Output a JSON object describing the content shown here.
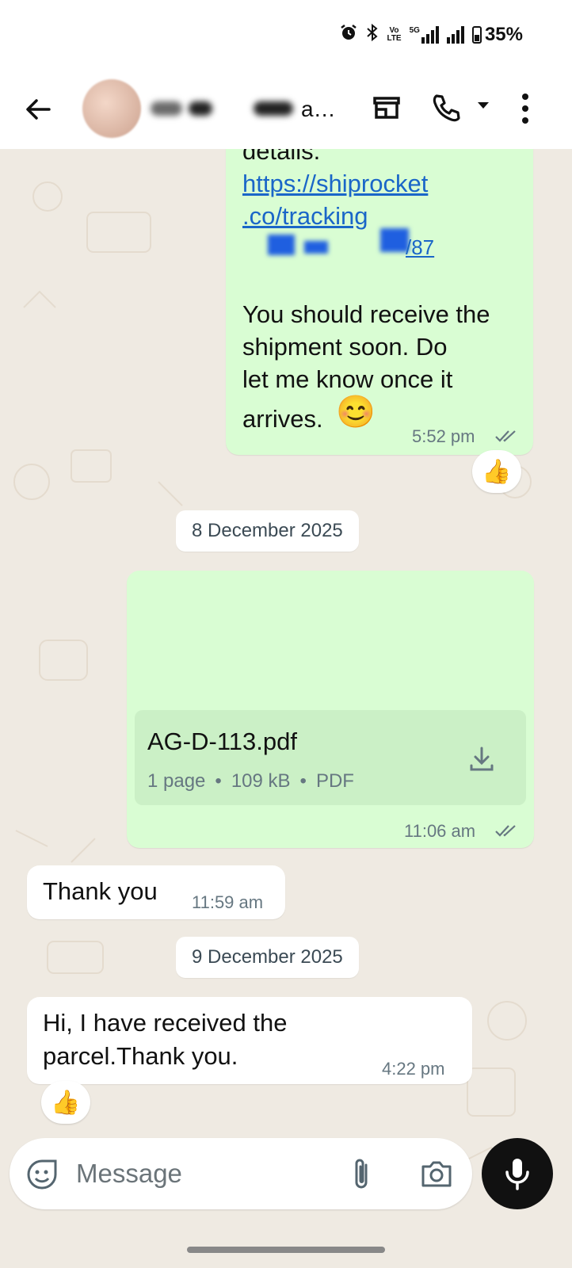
{
  "status_bar": {
    "network_label": "5G",
    "volte_label": "Vo",
    "lte_label": "LTE",
    "battery_percent": "35%"
  },
  "header": {
    "contact_name_visible": "a…"
  },
  "messages": [
    {
      "direction": "out",
      "partial_top": "details.",
      "link_line1": "https://shiprocket",
      "link_line2": ".co/tracking",
      "link_line3": "/87",
      "body": [
        "You should receive the",
        "shipment soon.  Do",
        "let me know once it",
        "arrives."
      ],
      "emoji": "😊",
      "time": "5:52 pm",
      "reaction": "👍"
    },
    {
      "date_separator": "8 December 2025"
    },
    {
      "direction": "out",
      "document": {
        "filename": "AG-D-113.pdf",
        "pages": "1 page",
        "size": "109 kB",
        "type": "PDF"
      },
      "time": "11:06 am"
    },
    {
      "direction": "in",
      "body": "Thank you",
      "time": "11:59 am"
    },
    {
      "date_separator": "9 December 2025"
    },
    {
      "direction": "in",
      "body": [
        "Hi, I have received the",
        "parcel.Thank you."
      ],
      "time": "4:22 pm",
      "reaction": "👍"
    }
  ],
  "composer": {
    "placeholder": "Message"
  },
  "colors": {
    "outgoing_bubble": "#d9fdd3",
    "incoming_bubble": "#ffffff",
    "chat_background": "#efeae2",
    "link": "#1a66c8",
    "mic_button": "#111111"
  },
  "icons": [
    "alarm-icon",
    "bluetooth-icon",
    "signal-icon",
    "battery-icon",
    "back-arrow-icon",
    "shop-icon",
    "phone-icon",
    "dropdown-icon",
    "more-vert-icon",
    "double-tick-icon",
    "download-icon",
    "sticker-icon",
    "attach-icon",
    "camera-icon",
    "mic-icon"
  ]
}
